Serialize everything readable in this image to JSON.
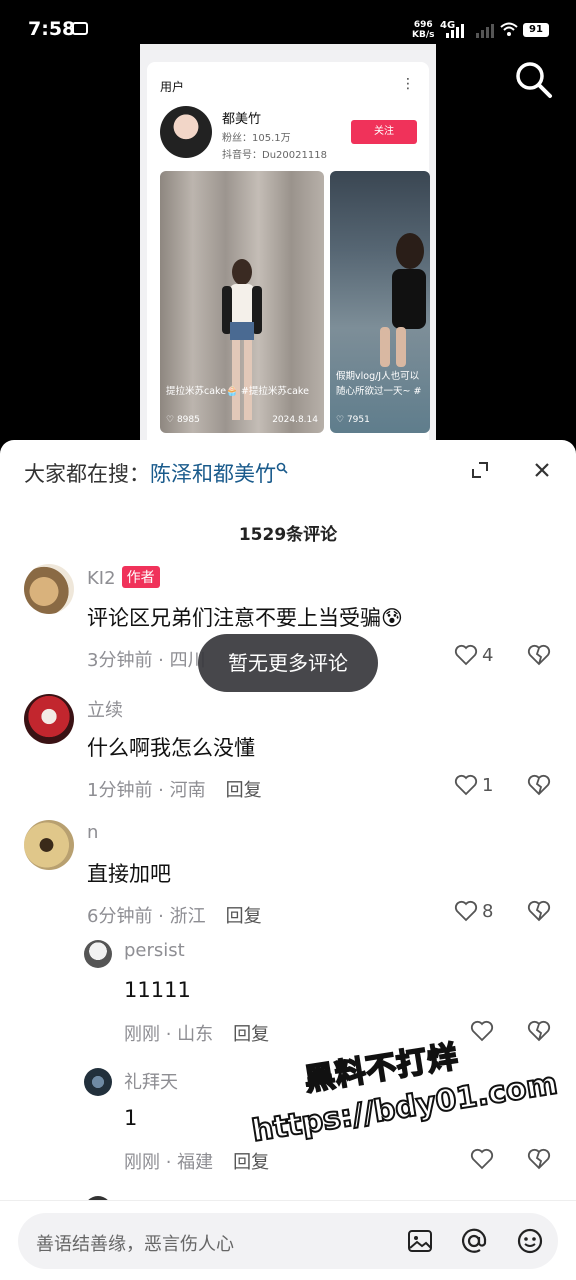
{
  "status_bar": {
    "time": "7:58",
    "net_speed": "696",
    "net_unit": "KB/s",
    "network": "4G",
    "battery": "91"
  },
  "embed": {
    "section_title": "用户",
    "user_name": "都美竹",
    "fans": "粉丝：105.1万",
    "douyin_id": "抖音号：Du20021118",
    "follow_label": "关注",
    "videos": [
      {
        "caption": "提拉米苏cake🧁 #提拉米苏cake",
        "likes": "8985",
        "date": "2024.8.14"
      },
      {
        "caption": "假期vlog/J人也可以随心所欲过一天~ #",
        "likes": "7951",
        "date": ""
      }
    ]
  },
  "sheet": {
    "trend_prefix": "大家都在搜：",
    "trend_query": "陈泽和都美竹",
    "comment_count": "1529条评论",
    "toast": "暂无更多评论",
    "reply_label": "回复",
    "comments": [
      {
        "name": "KI2",
        "badge": "作者",
        "text": "评论区兄弟们注意不要上当受骗😰",
        "time": "3分钟前",
        "region": "四川",
        "likes": "4"
      },
      {
        "name": "立续",
        "text": "什么啊我怎么没懂",
        "time": "1分钟前",
        "region": "河南",
        "likes": "1"
      },
      {
        "name": "n",
        "text": "直接加吧",
        "time": "6分钟前",
        "region": "浙江",
        "likes": "8"
      },
      {
        "name": "persist",
        "text": "11111",
        "time": "刚刚",
        "region": "山东",
        "likes": ""
      },
      {
        "name": "礼拜天",
        "text": "1",
        "time": "刚刚",
        "region": "福建",
        "likes": ""
      }
    ],
    "input_placeholder": "善语结善缘，恶言伤人心"
  },
  "watermark": {
    "line1": "黑料不打烊",
    "line2": "https://bdy01.com"
  },
  "colors": {
    "accent": "#f0325a",
    "link": "#1a5b8c",
    "muted": "#8e8e93"
  },
  "icons": [
    "search-icon",
    "expand-icon",
    "close-icon",
    "heart-icon",
    "broken-heart-icon",
    "image-icon",
    "at-icon",
    "emoji-icon"
  ]
}
